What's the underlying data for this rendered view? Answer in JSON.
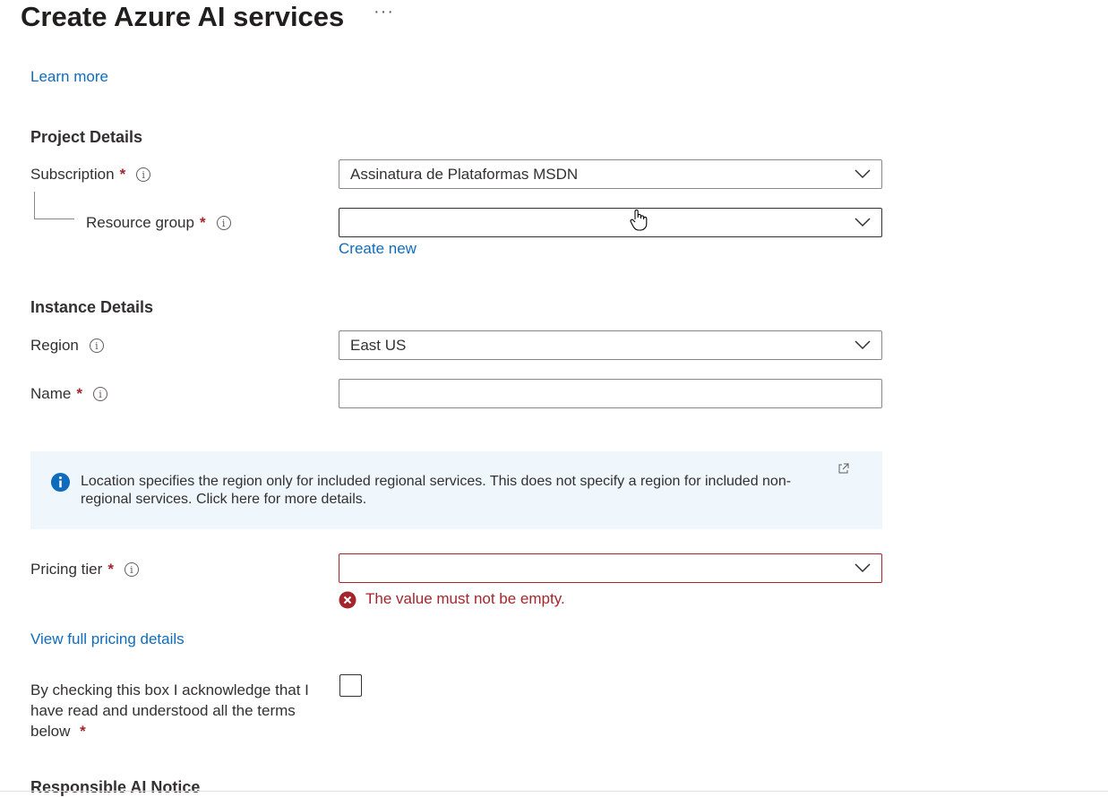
{
  "page": {
    "title": "Create Azure AI services",
    "more_label": "···",
    "learn_more": "Learn more"
  },
  "project": {
    "heading": "Project Details",
    "subscription_label": "Subscription",
    "subscription_value": "Assinatura de Plataformas MSDN",
    "resource_group_label": "Resource group",
    "resource_group_value": "",
    "create_new": "Create new"
  },
  "instance": {
    "heading": "Instance Details",
    "region_label": "Region",
    "region_value": "East US",
    "name_label": "Name",
    "name_value": ""
  },
  "banner": {
    "text": "Location specifies the region only for included regional services. This does not specify a region for included non-regional services. Click here for more details."
  },
  "pricing": {
    "label": "Pricing tier",
    "value": "",
    "error": "The value must not be empty.",
    "details_link": "View full pricing details"
  },
  "ack": {
    "text": "By checking this box I acknowledge that I have read and understood all the terms below",
    "checked": false
  },
  "responsible": {
    "heading": "Responsible AI Notice"
  },
  "common": {
    "required_mark": "*",
    "info_glyph": "i"
  },
  "icons": {
    "info": "info-icon",
    "chevron": "chevron-down-icon",
    "external": "external-link-icon",
    "error": "error-circle-icon",
    "cursor": "hand-cursor-icon"
  },
  "colors": {
    "link": "#0f6cbd",
    "error": "#a4262c",
    "banner_bg": "#eff6fc",
    "info_blue": "#0f6cbd"
  }
}
